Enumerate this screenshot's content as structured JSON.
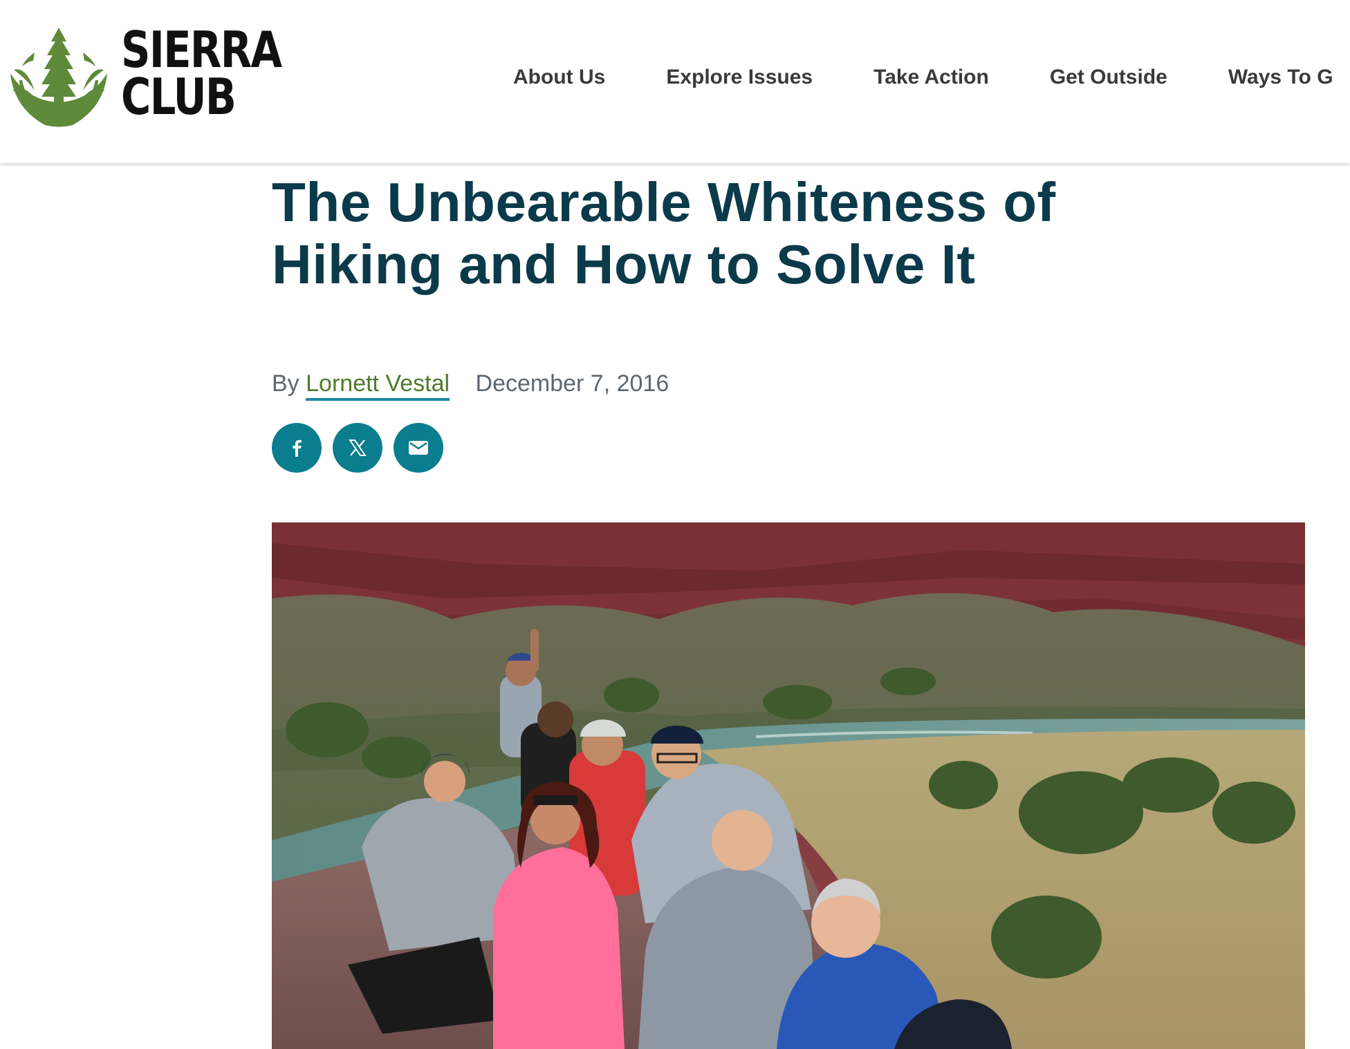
{
  "header": {
    "logo": {
      "line1": "SIERRA",
      "line2": "CLUB",
      "brand_green": "#5f8a3a",
      "icon": "sequoia-tree-logo"
    },
    "nav": [
      {
        "label": "About Us"
      },
      {
        "label": "Explore Issues"
      },
      {
        "label": "Take Action"
      },
      {
        "label": "Get Outside"
      },
      {
        "label": "Ways To G"
      }
    ]
  },
  "article": {
    "title": "The Unbearable Whiteness of Hiking and How to Solve It",
    "byline_prefix": "By",
    "author": "Lornett Vestal",
    "date": "December 7, 2016",
    "share": [
      {
        "icon": "facebook-icon"
      },
      {
        "icon": "x-icon"
      },
      {
        "icon": "email-icon"
      }
    ],
    "hero_image": {
      "subject": "group-of-hikers-above-river-canyon"
    }
  },
  "colors": {
    "title": "#0b3a4a",
    "byline": "#5c6770",
    "author_link": "#4e7a2a",
    "author_underline": "#1a8aa0",
    "share_button": "#0a7d8f",
    "nav_text": "#3a3a3a"
  }
}
